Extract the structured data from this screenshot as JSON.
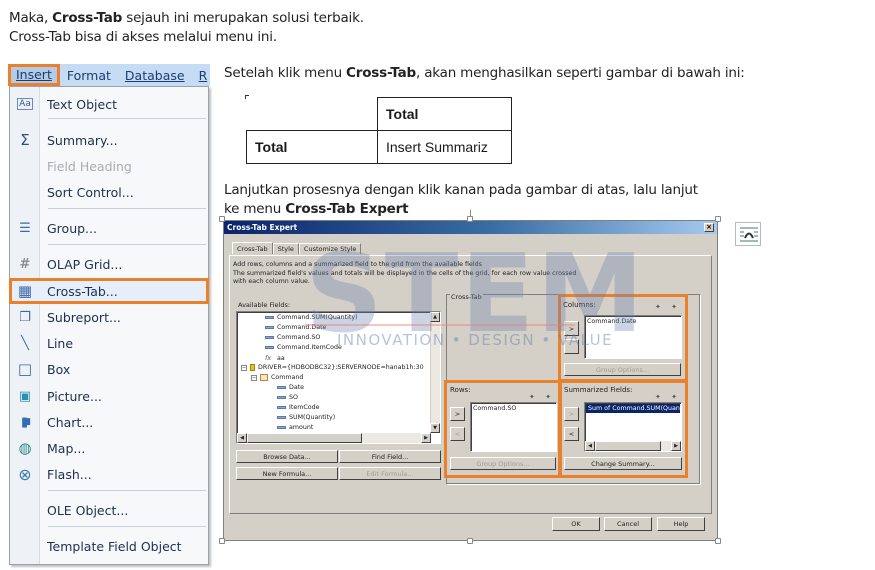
{
  "intro": {
    "line1_prefix": "Maka, ",
    "line1_bold": "Cross-Tab",
    "line1_suffix": " sejauh ini merupakan solusi terbaik.",
    "line2": "Cross-Tab bisa di akses melalui menu ini."
  },
  "after_menu": {
    "prefix": "Setelah klik menu ",
    "bold": "Cross-Tab",
    "suffix": ", akan menghasilkan seperti gambar di bawah ini:"
  },
  "continue_text": {
    "line1": "Lanjutkan prosesnya dengan klik kanan pada gambar di atas, lalu lanjut",
    "line2_prefix": "ke menu ",
    "line2_bold": "Cross-Tab Expert"
  },
  "menubar": {
    "items": [
      {
        "label": "Insert",
        "active": true
      },
      {
        "label": "Format"
      },
      {
        "label": "Database"
      },
      {
        "label": "R"
      }
    ]
  },
  "insert_menu": {
    "items": [
      {
        "label": "Text Object",
        "icon": "text-object-icon",
        "glyph": "Aa"
      },
      {
        "label": "Summary...",
        "icon": "sigma-icon",
        "glyph": "Σ"
      },
      {
        "label": "Field Heading",
        "icon": "",
        "glyph": "",
        "disabled": true
      },
      {
        "label": "Sort Control...",
        "icon": "",
        "glyph": ""
      },
      {
        "label": "Group...",
        "icon": "group-icon",
        "glyph": "☰"
      },
      {
        "label": "OLAP Grid...",
        "icon": "olap-grid-icon",
        "glyph": "#"
      },
      {
        "label": "Cross-Tab...",
        "icon": "cross-tab-icon",
        "glyph": "▦",
        "highlighted": true
      },
      {
        "label": "Subreport...",
        "icon": "subreport-icon",
        "glyph": "❐"
      },
      {
        "label": "Line",
        "icon": "line-icon",
        "glyph": "╲"
      },
      {
        "label": "Box",
        "icon": "box-icon",
        "glyph": "□"
      },
      {
        "label": "Picture...",
        "icon": "picture-icon",
        "glyph": "▣"
      },
      {
        "label": "Chart...",
        "icon": "chart-icon",
        "glyph": "▮"
      },
      {
        "label": "Map...",
        "icon": "map-icon",
        "glyph": "◍"
      },
      {
        "label": "Flash...",
        "icon": "flash-icon",
        "glyph": "⊗"
      },
      {
        "label": "OLE Object...",
        "icon": "",
        "glyph": ""
      },
      {
        "label": "Template Field Object",
        "icon": "",
        "glyph": ""
      }
    ]
  },
  "crosstab_preview": {
    "column_header": "Total",
    "row_header": "Total",
    "summary_cell": "Insert Summariz"
  },
  "dialog": {
    "title": "Cross-Tab Expert",
    "close_glyph": "×",
    "tabs": [
      "Cross-Tab",
      "Style",
      "Customize Style"
    ],
    "description": [
      "Add rows, columns and a summarized field to the grid from the available fields",
      "The summarized field's values and totals will be displayed in the cells of the grid, for each row value crossed",
      "with each column value."
    ],
    "available_fields_label": "Available Fields:",
    "available_fields": [
      {
        "label": "Command.SUM(Quantity)",
        "type": "field",
        "indent": 2
      },
      {
        "label": "Command.Date",
        "type": "field",
        "indent": 2
      },
      {
        "label": "Command.SO",
        "type": "field",
        "indent": 2
      },
      {
        "label": "Command.ItemCode",
        "type": "field",
        "indent": 2
      },
      {
        "label": "aa",
        "type": "formula",
        "indent": 2
      },
      {
        "label": "DRIVER={HDBODBC32};SERVERNODE=hanab1h:30",
        "type": "datasource",
        "indent": 0
      },
      {
        "label": "Command",
        "type": "table",
        "indent": 1
      },
      {
        "label": "Date",
        "type": "field",
        "indent": 3
      },
      {
        "label": "SO",
        "type": "field",
        "indent": 3
      },
      {
        "label": "ItemCode",
        "type": "field",
        "indent": 3
      },
      {
        "label": "SUM(Quantity)",
        "type": "field",
        "indent": 3
      },
      {
        "label": "amount",
        "type": "field",
        "indent": 3
      }
    ],
    "buttons": {
      "browse_data": "Browse Data...",
      "find_field": "Find Field...",
      "new_formula": "New Formula...",
      "edit_formula": "Edit Formula...",
      "ok": "OK",
      "cancel": "Cancel",
      "help": "Help",
      "group_options": "Group Options...",
      "change_summary": "Change Summary...",
      "add": ">",
      "remove": "<"
    },
    "crosstab_group_label": "Cross-Tab",
    "columns": {
      "label": "Columns:",
      "items": [
        "Command.Date"
      ]
    },
    "rows": {
      "label": "Rows:",
      "items": [
        "Command.SO"
      ]
    },
    "summarized": {
      "label": "Summarized Fields:",
      "items": [
        "Sum of Command.SUM(Quantity)"
      ]
    },
    "move_arrows": "✦ ✦"
  },
  "watermark": {
    "brand": "STEM",
    "tagline": "INNOVATION • DESIGN • VALUE"
  },
  "colors": {
    "highlight_outline": "#e8802c",
    "menubar_bg": "#c6dcf4",
    "title_gradient_start": "#0a246a",
    "dialog_bg": "#d4d0c8",
    "selection": "#0a246a"
  }
}
